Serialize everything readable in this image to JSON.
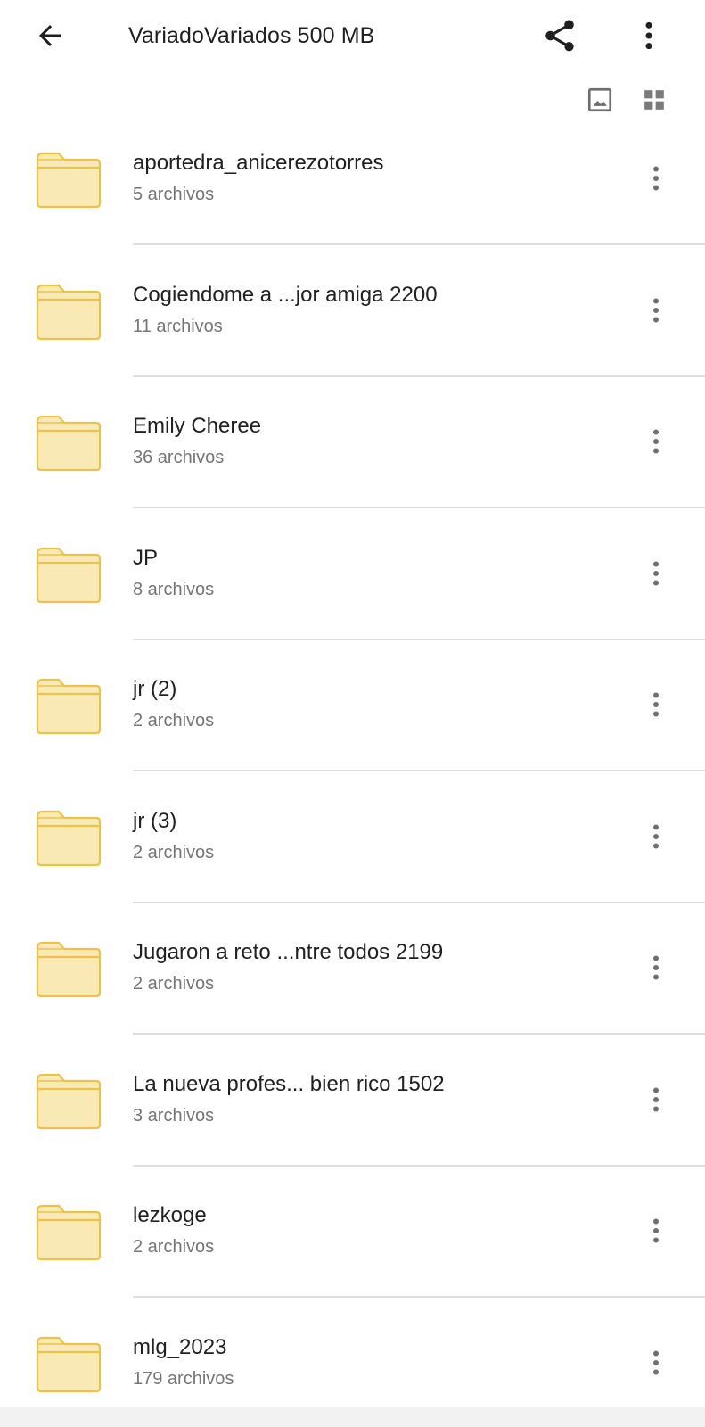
{
  "header": {
    "title": "VariadoVariados 500 MB",
    "back_icon": "arrow-left-icon",
    "share_icon": "share-icon",
    "more_icon": "more-vert-icon"
  },
  "view_toggles": {
    "image_icon": "image-icon",
    "grid_icon": "grid-view-icon"
  },
  "colors": {
    "folder_fill": "#f9e9b4",
    "folder_stroke": "#ebc24c",
    "icon": "#1f1f1f",
    "secondary_text": "#757575",
    "divider": "#dedede"
  },
  "folders": [
    {
      "name": "aportedra_anicerezotorres",
      "count": "5 archivos"
    },
    {
      "name": "Cogiendome a ...jor amiga 2200",
      "count": "11 archivos"
    },
    {
      "name": "Emily Cheree",
      "count": "36 archivos"
    },
    {
      "name": "JP",
      "count": "8 archivos"
    },
    {
      "name": "jr (2)",
      "count": "2 archivos"
    },
    {
      "name": "jr (3)",
      "count": "2 archivos"
    },
    {
      "name": "Jugaron a reto ...ntre todos 2199",
      "count": "2 archivos"
    },
    {
      "name": "La nueva profes... bien rico 1502",
      "count": "3 archivos"
    },
    {
      "name": "lezkoge",
      "count": "2 archivos"
    },
    {
      "name": "mlg_2023",
      "count": "179 archivos"
    }
  ]
}
